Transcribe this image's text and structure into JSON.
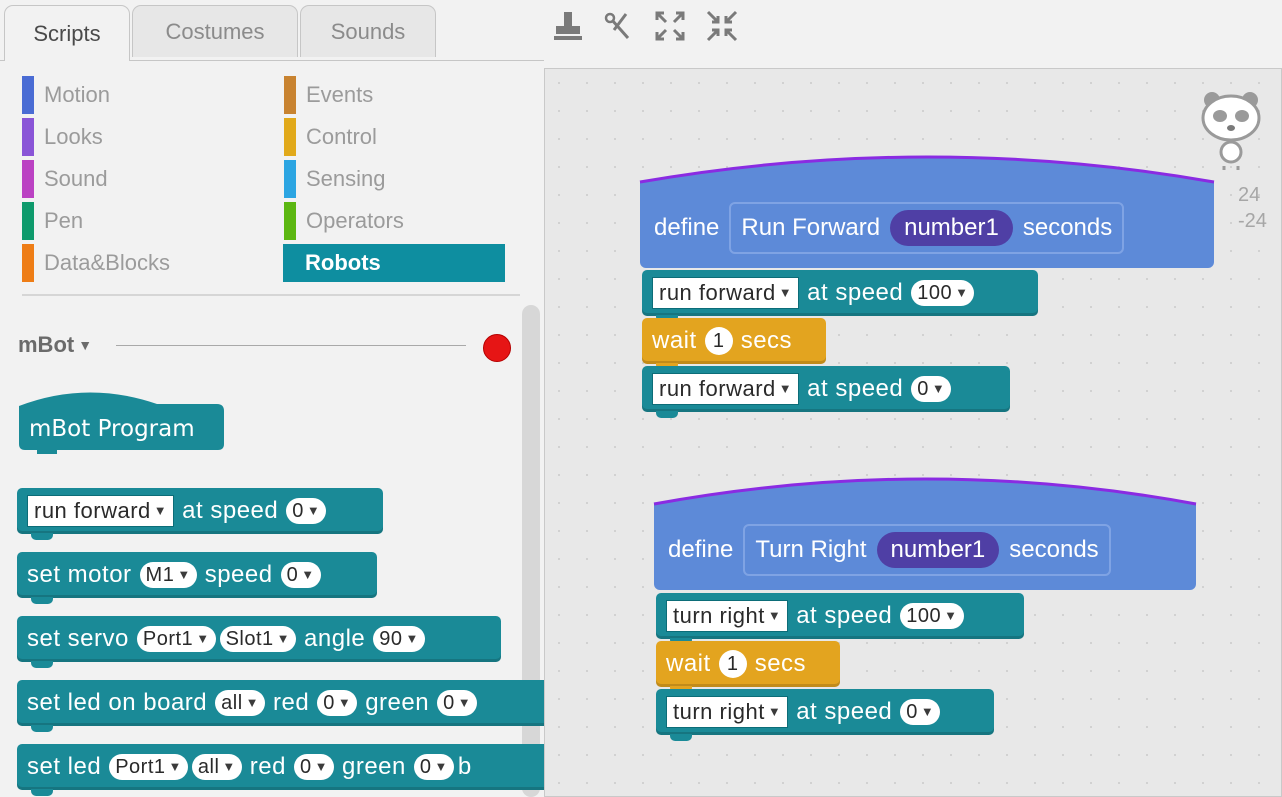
{
  "tabs": [
    "Scripts",
    "Costumes",
    "Sounds"
  ],
  "toolbar": {
    "tools": [
      "stamp-icon",
      "scissors-icon",
      "grow-icon",
      "shrink-icon"
    ]
  },
  "categories": {
    "left": [
      {
        "label": "Motion",
        "color": "#4a6cd4"
      },
      {
        "label": "Looks",
        "color": "#8a55d7"
      },
      {
        "label": "Sound",
        "color": "#bb42c3"
      },
      {
        "label": "Pen",
        "color": "#0e9a6c"
      },
      {
        "label": "Data&Blocks",
        "color": "#ee7d16"
      }
    ],
    "right": [
      {
        "label": "Events",
        "color": "#c88330"
      },
      {
        "label": "Control",
        "color": "#e1a91a"
      },
      {
        "label": "Sensing",
        "color": "#2ca5e2"
      },
      {
        "label": "Operators",
        "color": "#5cb712"
      },
      {
        "label": "Robots",
        "color": "#0e8ea0"
      }
    ]
  },
  "palette": {
    "device": "mBot",
    "program_block": "mBot Program",
    "run_block": {
      "dropdown": "run forward",
      "mid": "at speed",
      "speed": "0"
    },
    "motor_block": {
      "prefix": "set motor",
      "motor": "M1",
      "mid": "speed",
      "speed": "0"
    },
    "servo_block": {
      "prefix": "set servo",
      "port": "Port1",
      "slot": "Slot1",
      "mid": "angle",
      "angle": "90"
    },
    "led_board_block": {
      "prefix": "set led on board",
      "which": "all",
      "red_label": "red",
      "red": "0",
      "green_label": "green",
      "green": "0"
    },
    "led_port_block": {
      "prefix": "set led",
      "port": "Port1",
      "which": "all",
      "red_label": "red",
      "red": "0",
      "green_label": "green",
      "green": "0",
      "tail": "b"
    }
  },
  "scripts": {
    "coords_x": "24",
    "coords_y": "-24",
    "script1": {
      "define": "define",
      "name": "Run Forward",
      "param": "number1",
      "suffix": "seconds",
      "b1": {
        "dropdown": "run forward",
        "mid": "at speed",
        "speed": "100"
      },
      "wait": {
        "label": "wait",
        "value": "1",
        "unit": "secs"
      },
      "b2": {
        "dropdown": "run forward",
        "mid": "at speed",
        "speed": "0"
      }
    },
    "script2": {
      "define": "define",
      "name": "Turn Right",
      "param": "number1",
      "suffix": "seconds",
      "b1": {
        "dropdown": "turn right",
        "mid": "at speed",
        "speed": "100"
      },
      "wait": {
        "label": "wait",
        "value": "1",
        "unit": "secs"
      },
      "b2": {
        "dropdown": "turn right",
        "mid": "at speed",
        "speed": "0"
      }
    }
  }
}
